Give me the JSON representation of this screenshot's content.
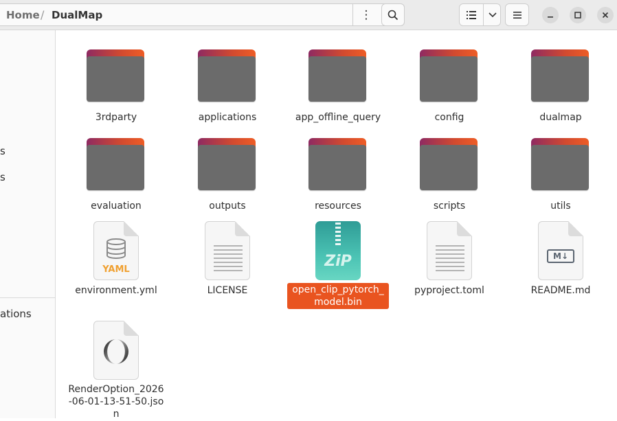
{
  "header": {
    "breadcrumb": {
      "home": "Home",
      "separator": "/",
      "current": "DualMap"
    },
    "icons": {
      "path_menu": "vertical-dots-icon",
      "search": "search-icon",
      "view_list": "list-view-icon",
      "view_dropdown": "chevron-down-icon",
      "main_menu": "hamburger-menu-icon",
      "minimize": "minimize-icon",
      "maximize": "maximize-icon",
      "close": "close-icon"
    }
  },
  "sidebar": {
    "items": [
      {
        "label": "s"
      },
      {
        "label": "s"
      },
      {
        "label": "ations"
      }
    ]
  },
  "files": [
    {
      "name": "3rdparty",
      "kind": "folder"
    },
    {
      "name": "applications",
      "kind": "folder"
    },
    {
      "name": "app_offline_query",
      "kind": "folder"
    },
    {
      "name": "config",
      "kind": "folder"
    },
    {
      "name": "dualmap",
      "kind": "folder"
    },
    {
      "name": "evaluation",
      "kind": "folder"
    },
    {
      "name": "outputs",
      "kind": "folder"
    },
    {
      "name": "resources",
      "kind": "folder"
    },
    {
      "name": "scripts",
      "kind": "folder"
    },
    {
      "name": "utils",
      "kind": "folder"
    },
    {
      "name": "environment.yml",
      "kind": "yaml",
      "badge": "YAML"
    },
    {
      "name": "LICENSE",
      "kind": "text"
    },
    {
      "name": "open_clip_pytorch_model.bin",
      "kind": "zip",
      "badge": "ZiP",
      "selected": true
    },
    {
      "name": "pyproject.toml",
      "kind": "text"
    },
    {
      "name": "README.md",
      "kind": "markdown",
      "badge": "M↓"
    },
    {
      "name": "RenderOption_2026-06-01-13-51-50.json",
      "kind": "json"
    }
  ],
  "colors": {
    "accent": "#e95420",
    "folder_body": "#6b6b6b",
    "folder_tab_left": "#8e2a62",
    "folder_tab_right": "#ee5d26",
    "zip_teal": "#4bc3b4",
    "yaml_orange": "#f0a030"
  }
}
